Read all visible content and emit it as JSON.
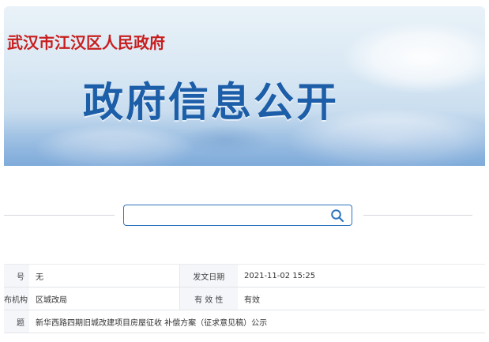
{
  "banner": {
    "gov_name": "武汉市江汉区人民政府",
    "title": "政府信息公开"
  },
  "search": {
    "placeholder": "",
    "value": "",
    "icon": "search-icon"
  },
  "info": {
    "rows": [
      {
        "label1": "号",
        "value1": "无",
        "label2": "发文日期",
        "value2": "2021-11-02 15:25"
      },
      {
        "label1": "布机构",
        "value1": "区城改局",
        "label2": "有 效 性",
        "value2": "有效"
      },
      {
        "label1": "题",
        "value1": "新华西路四期旧城改建项目房屋征收 补偿方案（征求意见稿）公示"
      }
    ]
  },
  "colors": {
    "gov_name": "#c81e1e",
    "title": "#1d5ea8",
    "search_border": "#2f74c0"
  }
}
